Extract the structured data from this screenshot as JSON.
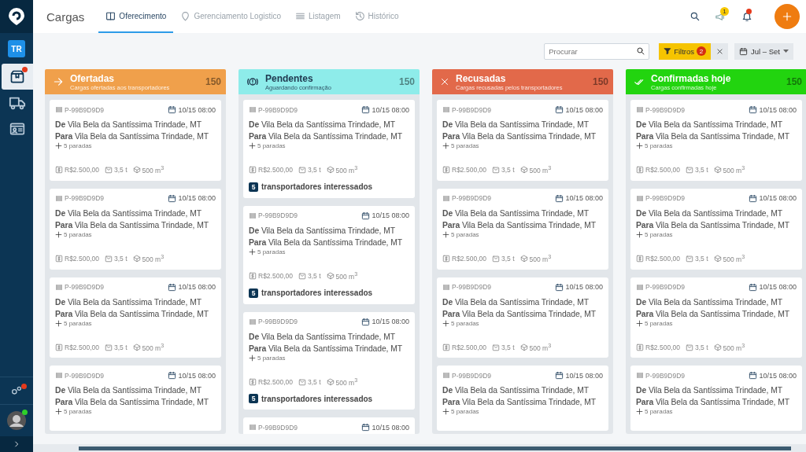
{
  "sidebar": {
    "user_initials": "TR",
    "items": [
      {
        "kind": "box",
        "selected": true,
        "alert": true
      },
      {
        "kind": "truck",
        "selected": false,
        "alert": false
      },
      {
        "kind": "id-card",
        "selected": false,
        "alert": false
      }
    ],
    "settings_alert": true,
    "user_online": true
  },
  "header": {
    "title": "Cargas",
    "tabs": [
      {
        "kind": "board",
        "label": "Oferecimento",
        "selected": true
      },
      {
        "kind": "pin",
        "label": "Gerenciamento Logistico",
        "selected": false
      },
      {
        "kind": "list",
        "label": "Listagem",
        "selected": false
      },
      {
        "kind": "history",
        "label": "Histórico",
        "selected": false
      }
    ],
    "messages_count": "1",
    "bell_alert": true
  },
  "toolbar": {
    "search": {
      "placeholder": "Procurar"
    },
    "filter": {
      "label": "Filtros",
      "count": "2"
    },
    "date_range": "Jul – Set"
  },
  "columns": [
    {
      "kind": "offered",
      "title": "Ofertadas",
      "subtitle": "Cargas ofertadas aos transportadores",
      "count": "150",
      "color": "#f0a04b",
      "cards": [
        {
          "id": "P-99B9D9D9",
          "date": "10/15 08:00",
          "from": "**De** Vila Bela da Santíssima Trindade, MT",
          "to": "**Para** Vila Bela da Santíssima Trindade, MT",
          "stops": "5 paradas",
          "price": "R$2.500,00",
          "weight": "3,5 t",
          "volume": "500 m$^{3}$"
        },
        {
          "id": "P-99B9D9D9",
          "date": "10/15 08:00",
          "from": "**De** Vila Bela da Santíssima Trindade, MT",
          "to": "**Para** Vila Bela da Santíssima Trindade, MT",
          "stops": "5 paradas",
          "price": "R$2.500,00",
          "weight": "3,5 t",
          "volume": "500 m$^{3}$"
        },
        {
          "id": "P-99B9D9D9",
          "date": "10/15 08:00",
          "from": "**De** Vila Bela da Santíssima Trindade, MT",
          "to": "**Para** Vila Bela da Santíssima Trindade, MT",
          "stops": "5 paradas",
          "price": "R$2.500,00",
          "weight": "3,5 t",
          "volume": "500 m$^{3}$"
        },
        {
          "id": "P-99B9D9D9",
          "date": "10/15 08:00",
          "from": "**De** Vila Bela da Santíssima Trindade, MT",
          "to": "**Para** Vila Bela da Santíssima Trindade, MT",
          "stops": "5 paradas"
        }
      ]
    },
    {
      "kind": "pending",
      "title": "Pendentes",
      "subtitle": "Aguardando confirmação",
      "count": "150",
      "color": "#8eecea",
      "cards": [
        {
          "id": "P-99B9D9D9",
          "date": "10/15 08:00",
          "from": "**De** Vila Bela da Santíssima Trindade, MT",
          "to": "**Para** Vila Bela da Santíssima Trindade, MT",
          "stops": "5 paradas",
          "price": "R$2.500,00",
          "weight": "3,5 t",
          "volume": "500 m$^{3}$",
          "interested_count": "5",
          "interested_label": "transportadores interessados"
        },
        {
          "id": "P-99B9D9D9",
          "date": "10/15 08:00",
          "from": "**De** Vila Bela da Santíssima Trindade, MT",
          "to": "**Para** Vila Bela da Santíssima Trindade, MT",
          "stops": "5 paradas",
          "price": "R$2.500,00",
          "weight": "3,5 t",
          "volume": "500 m$^{3}$",
          "interested_count": "5",
          "interested_label": "transportadores interessados"
        },
        {
          "id": "P-99B9D9D9",
          "date": "10/15 08:00",
          "from": "**De** Vila Bela da Santíssima Trindade, MT",
          "to": "**Para** Vila Bela da Santíssima Trindade, MT",
          "stops": "5 paradas",
          "price": "R$2.500,00",
          "weight": "3,5 t",
          "volume": "500 m$^{3}$",
          "interested_count": "5",
          "interested_label": "transportadores interessados"
        },
        {
          "id": "P-99B9D9D9",
          "date": "10/15 08:00"
        }
      ]
    },
    {
      "kind": "refused",
      "title": "Recusadas",
      "subtitle": "Cargas recusadas pelos transportadores",
      "count": "150",
      "color": "#e2694a",
      "cards": [
        {
          "id": "P-99B9D9D9",
          "date": "10/15 08:00",
          "from": "**De** Vila Bela da Santíssima Trindade, MT",
          "to": "**Para** Vila Bela da Santíssima Trindade, MT",
          "stops": "5 paradas",
          "price": "R$2.500,00",
          "weight": "3,5 t",
          "volume": "500 m$^{3}$"
        },
        {
          "id": "P-99B9D9D9",
          "date": "10/15 08:00",
          "from": "**De** Vila Bela da Santíssima Trindade, MT",
          "to": "**Para** Vila Bela da Santíssima Trindade, MT",
          "stops": "5 paradas",
          "price": "R$2.500,00",
          "weight": "3,5 t",
          "volume": "500 m$^{3}$"
        },
        {
          "id": "P-99B9D9D9",
          "date": "10/15 08:00",
          "from": "**De** Vila Bela da Santíssima Trindade, MT",
          "to": "**Para** Vila Bela da Santíssima Trindade, MT",
          "stops": "5 paradas",
          "price": "R$2.500,00",
          "weight": "3,5 t",
          "volume": "500 m$^{3}$"
        },
        {
          "id": "P-99B9D9D9",
          "date": "10/15 08:00",
          "from": "**De** Vila Bela da Santíssima Trindade, MT",
          "to": "**Para** Vila Bela da Santíssima Trindade, MT",
          "stops": "5 paradas"
        }
      ]
    },
    {
      "kind": "confirmed",
      "title": "Confirmadas hoje",
      "subtitle": "Cargas confirmadas hoje",
      "count": "150",
      "color": "#22d40f",
      "cards": [
        {
          "id": "P-99B9D9D9",
          "date": "10/15 08:00",
          "from": "**De** Vila Bela da Santíssima Trindade, MT",
          "to": "**Para** Vila Bela da Santíssima Trindade, MT",
          "stops": "5 paradas",
          "price": "R$2.500,00",
          "weight": "3,5 t",
          "volume": "500 m$^{3}$"
        },
        {
          "id": "P-99B9D9D9",
          "date": "10/15 08:00",
          "from": "**De** Vila Bela da Santíssima Trindade, MT",
          "to": "**Para** Vila Bela da Santíssima Trindade, MT",
          "stops": "5 paradas",
          "price": "R$2.500,00",
          "weight": "3,5 t",
          "volume": "500 m$^{3}$"
        },
        {
          "id": "P-99B9D9D9",
          "date": "10/15 08:00",
          "from": "**De** Vila Bela da Santíssima Trindade, MT",
          "to": "**Para** Vila Bela da Santíssima Trindade, MT",
          "stops": "5 paradas",
          "price": "R$2.500,00",
          "weight": "3,5 t",
          "volume": "500 m$^{3}$"
        },
        {
          "id": "P-99B9D9D9",
          "date": "10/15 08:00",
          "from": "**De** Vila Bela da Santíssima Trindade, MT",
          "to": "**Para** Vila Bela da Santíssima Trindade, MT",
          "stops": "5 paradas"
        }
      ]
    }
  ]
}
